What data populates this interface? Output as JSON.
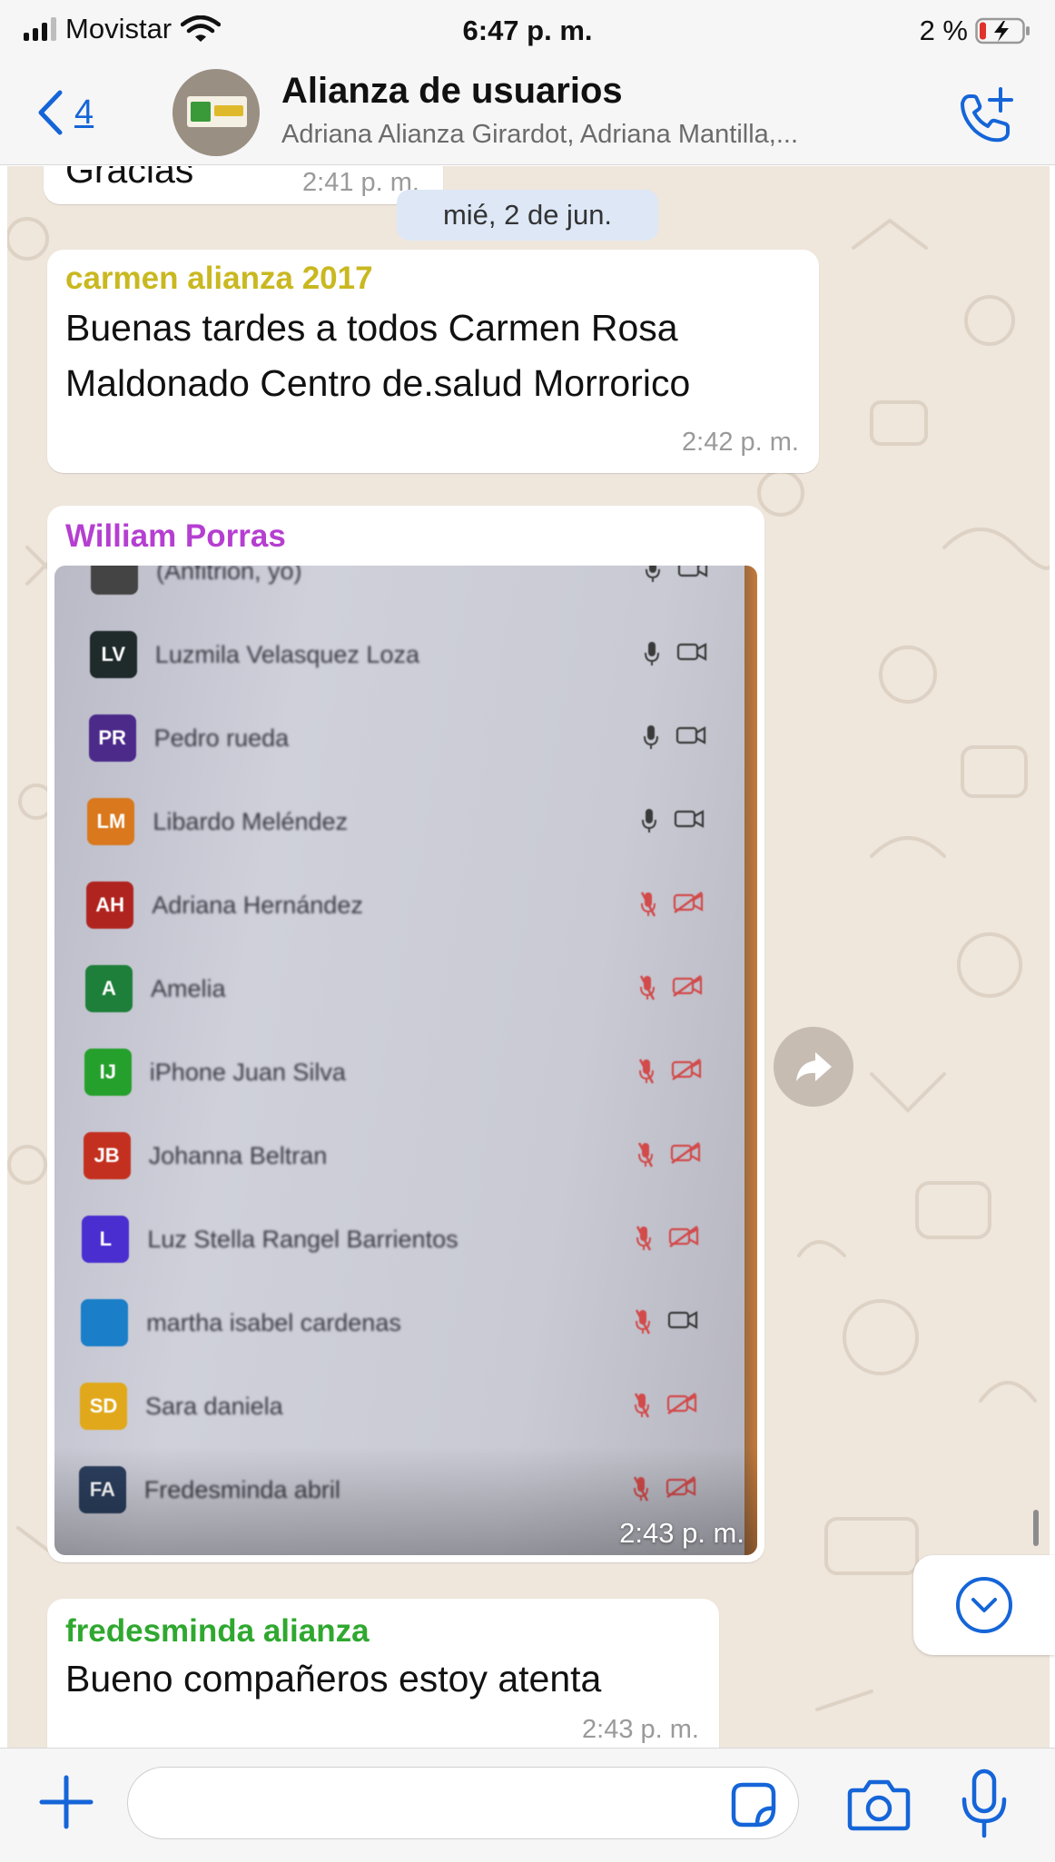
{
  "status_bar": {
    "carrier": "Movistar",
    "time": "6:47 p. m.",
    "battery": "2 %"
  },
  "header": {
    "back_count": "4",
    "title": "Alianza de usuarios",
    "subtitle": "Adriana Alianza Girardot, Adriana Mantilla,..."
  },
  "messages": [
    {
      "type": "text",
      "text": "Gracias",
      "time": "2:41 p. m."
    },
    {
      "type": "date",
      "text": "mié, 2 de jun."
    },
    {
      "type": "text",
      "sender": "carmen alianza 2017",
      "sender_color": "#c9b820",
      "text": "Buenas tardes a todos Carmen Rosa Maldonado Centro de.salud Morrorico",
      "time": "2:42 p. m."
    },
    {
      "type": "image",
      "sender": "William Porras",
      "sender_color": "#b53fd1",
      "time": "2:43 p. m.",
      "photo_rows": [
        {
          "initials": "",
          "name": "(Anfitrión, yo)",
          "avatar_color": "#444444",
          "muted": false
        },
        {
          "initials": "LV",
          "name": "Luzmila Velasquez Loza",
          "avatar_color": "#1f2a2a",
          "muted": false
        },
        {
          "initials": "PR",
          "name": "Pedro rueda",
          "avatar_color": "#4b2a8a",
          "muted": false
        },
        {
          "initials": "LM",
          "name": "Libardo Meléndez",
          "avatar_color": "#d9781c",
          "muted": false
        },
        {
          "initials": "AH",
          "name": "Adriana Hernández",
          "avatar_color": "#b0241f",
          "muted": true
        },
        {
          "initials": "A",
          "name": "Amelia",
          "avatar_color": "#1d7f3a",
          "muted": true
        },
        {
          "initials": "IJ",
          "name": "iPhone Juan Silva",
          "avatar_color": "#25a02c",
          "muted": true
        },
        {
          "initials": "JB",
          "name": "Johanna Beltran",
          "avatar_color": "#c4301f",
          "muted": true
        },
        {
          "initials": "L",
          "name": "Luz Stella Rangel Barrientos",
          "avatar_color": "#4a2ed0",
          "muted": true
        },
        {
          "initials": "",
          "name": "martha isabel cardenas",
          "avatar_color": "#1a7ec8",
          "muted": true,
          "video_on": true
        },
        {
          "initials": "SD",
          "name": "Sara daniela",
          "avatar_color": "#e0a81a",
          "muted": true
        },
        {
          "initials": "FA",
          "name": "Fredesminda abril",
          "avatar_color": "#2b3f5e",
          "muted": true
        }
      ]
    },
    {
      "type": "text",
      "sender": "fredesminda alianza",
      "sender_color": "#2fa82f",
      "text": "Bueno compañeros estoy atenta",
      "time": "2:43 p. m."
    }
  ],
  "input": {
    "placeholder": "",
    "value": ""
  },
  "icons": {
    "back": "chevron-left-icon",
    "call": "add-call-icon",
    "forward": "forward-icon",
    "scroll": "chevron-down-circle-icon",
    "plus": "plus-icon",
    "sticker": "sticker-icon",
    "camera": "camera-icon",
    "mic": "microphone-icon"
  },
  "colors": {
    "accent": "#1565d8",
    "chat_background": "#efe6dc",
    "bubble": "#ffffff",
    "date_pill": "#dde7f6",
    "muted_icon": "#d24a4a"
  }
}
